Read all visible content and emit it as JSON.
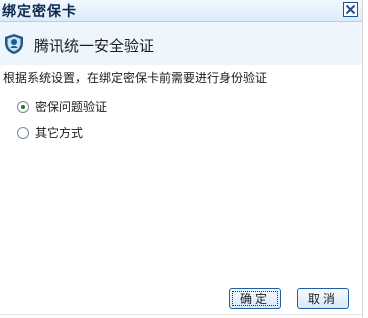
{
  "dialog": {
    "title": "绑定密保卡",
    "close_symbol": "×",
    "header_text": "腾讯统一安全验证",
    "info_text": "根据系统设置，在绑定密保卡前需要进行身份验证",
    "options": [
      {
        "label": "密保问题验证",
        "checked": true
      },
      {
        "label": "其它方式",
        "checked": false
      }
    ],
    "buttons": {
      "ok": "确定",
      "cancel": "取消"
    }
  },
  "colors": {
    "titlebar": "#dcebfa",
    "header_band": "#eef5fd",
    "shield": "#1f5a8c",
    "button_border": "#1f5fa8"
  },
  "icons": {
    "shield": "shield-icon",
    "close": "close-icon"
  }
}
